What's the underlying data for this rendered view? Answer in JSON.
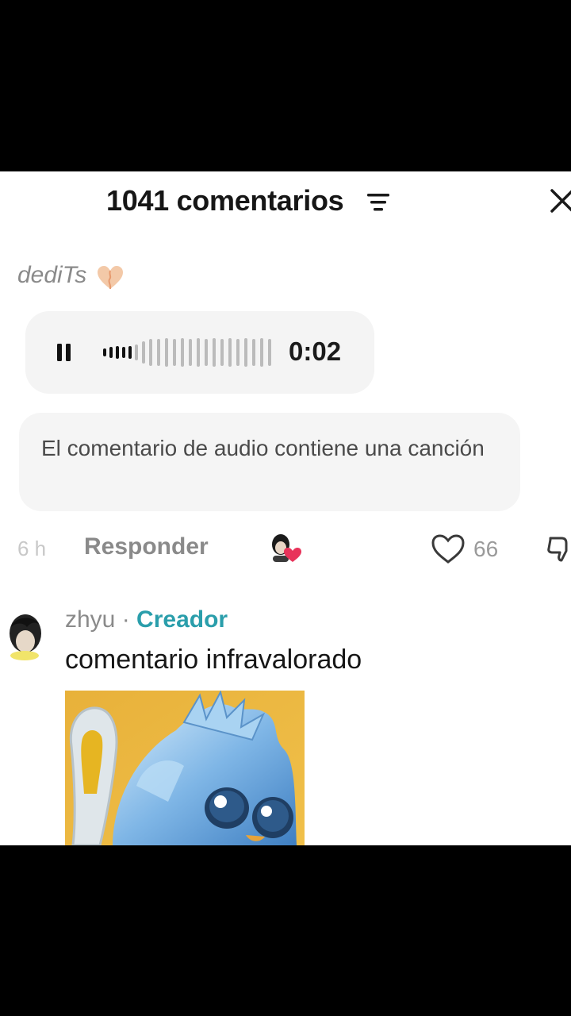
{
  "header": {
    "title": "1041 comentarios",
    "filter_icon": "filter-icon",
    "close_icon": "close-icon"
  },
  "comment": {
    "username": "dediTs",
    "username_emoji": "heart-emoji",
    "audio": {
      "state_icon": "pause-icon",
      "duration": "0:02"
    },
    "notice": "El comentario de audio contiene una canción",
    "time": "6 h",
    "reply_label": "Responder",
    "creator_liked_icon": "creator-liked-icon",
    "likes": "66",
    "like_icon": "heart-outline-icon",
    "dislike_icon": "thumbs-down-icon"
  },
  "reply": {
    "username": "zhyu",
    "separator": " · ",
    "badge": "Creador",
    "text": "comentario infravalorado",
    "image_icon": "sticker-image"
  },
  "colors": {
    "creator_badge": "#2a9eab",
    "panel_bg": "#ffffff",
    "letterbox": "#000000",
    "like_heart_badge": "#e8335a"
  }
}
